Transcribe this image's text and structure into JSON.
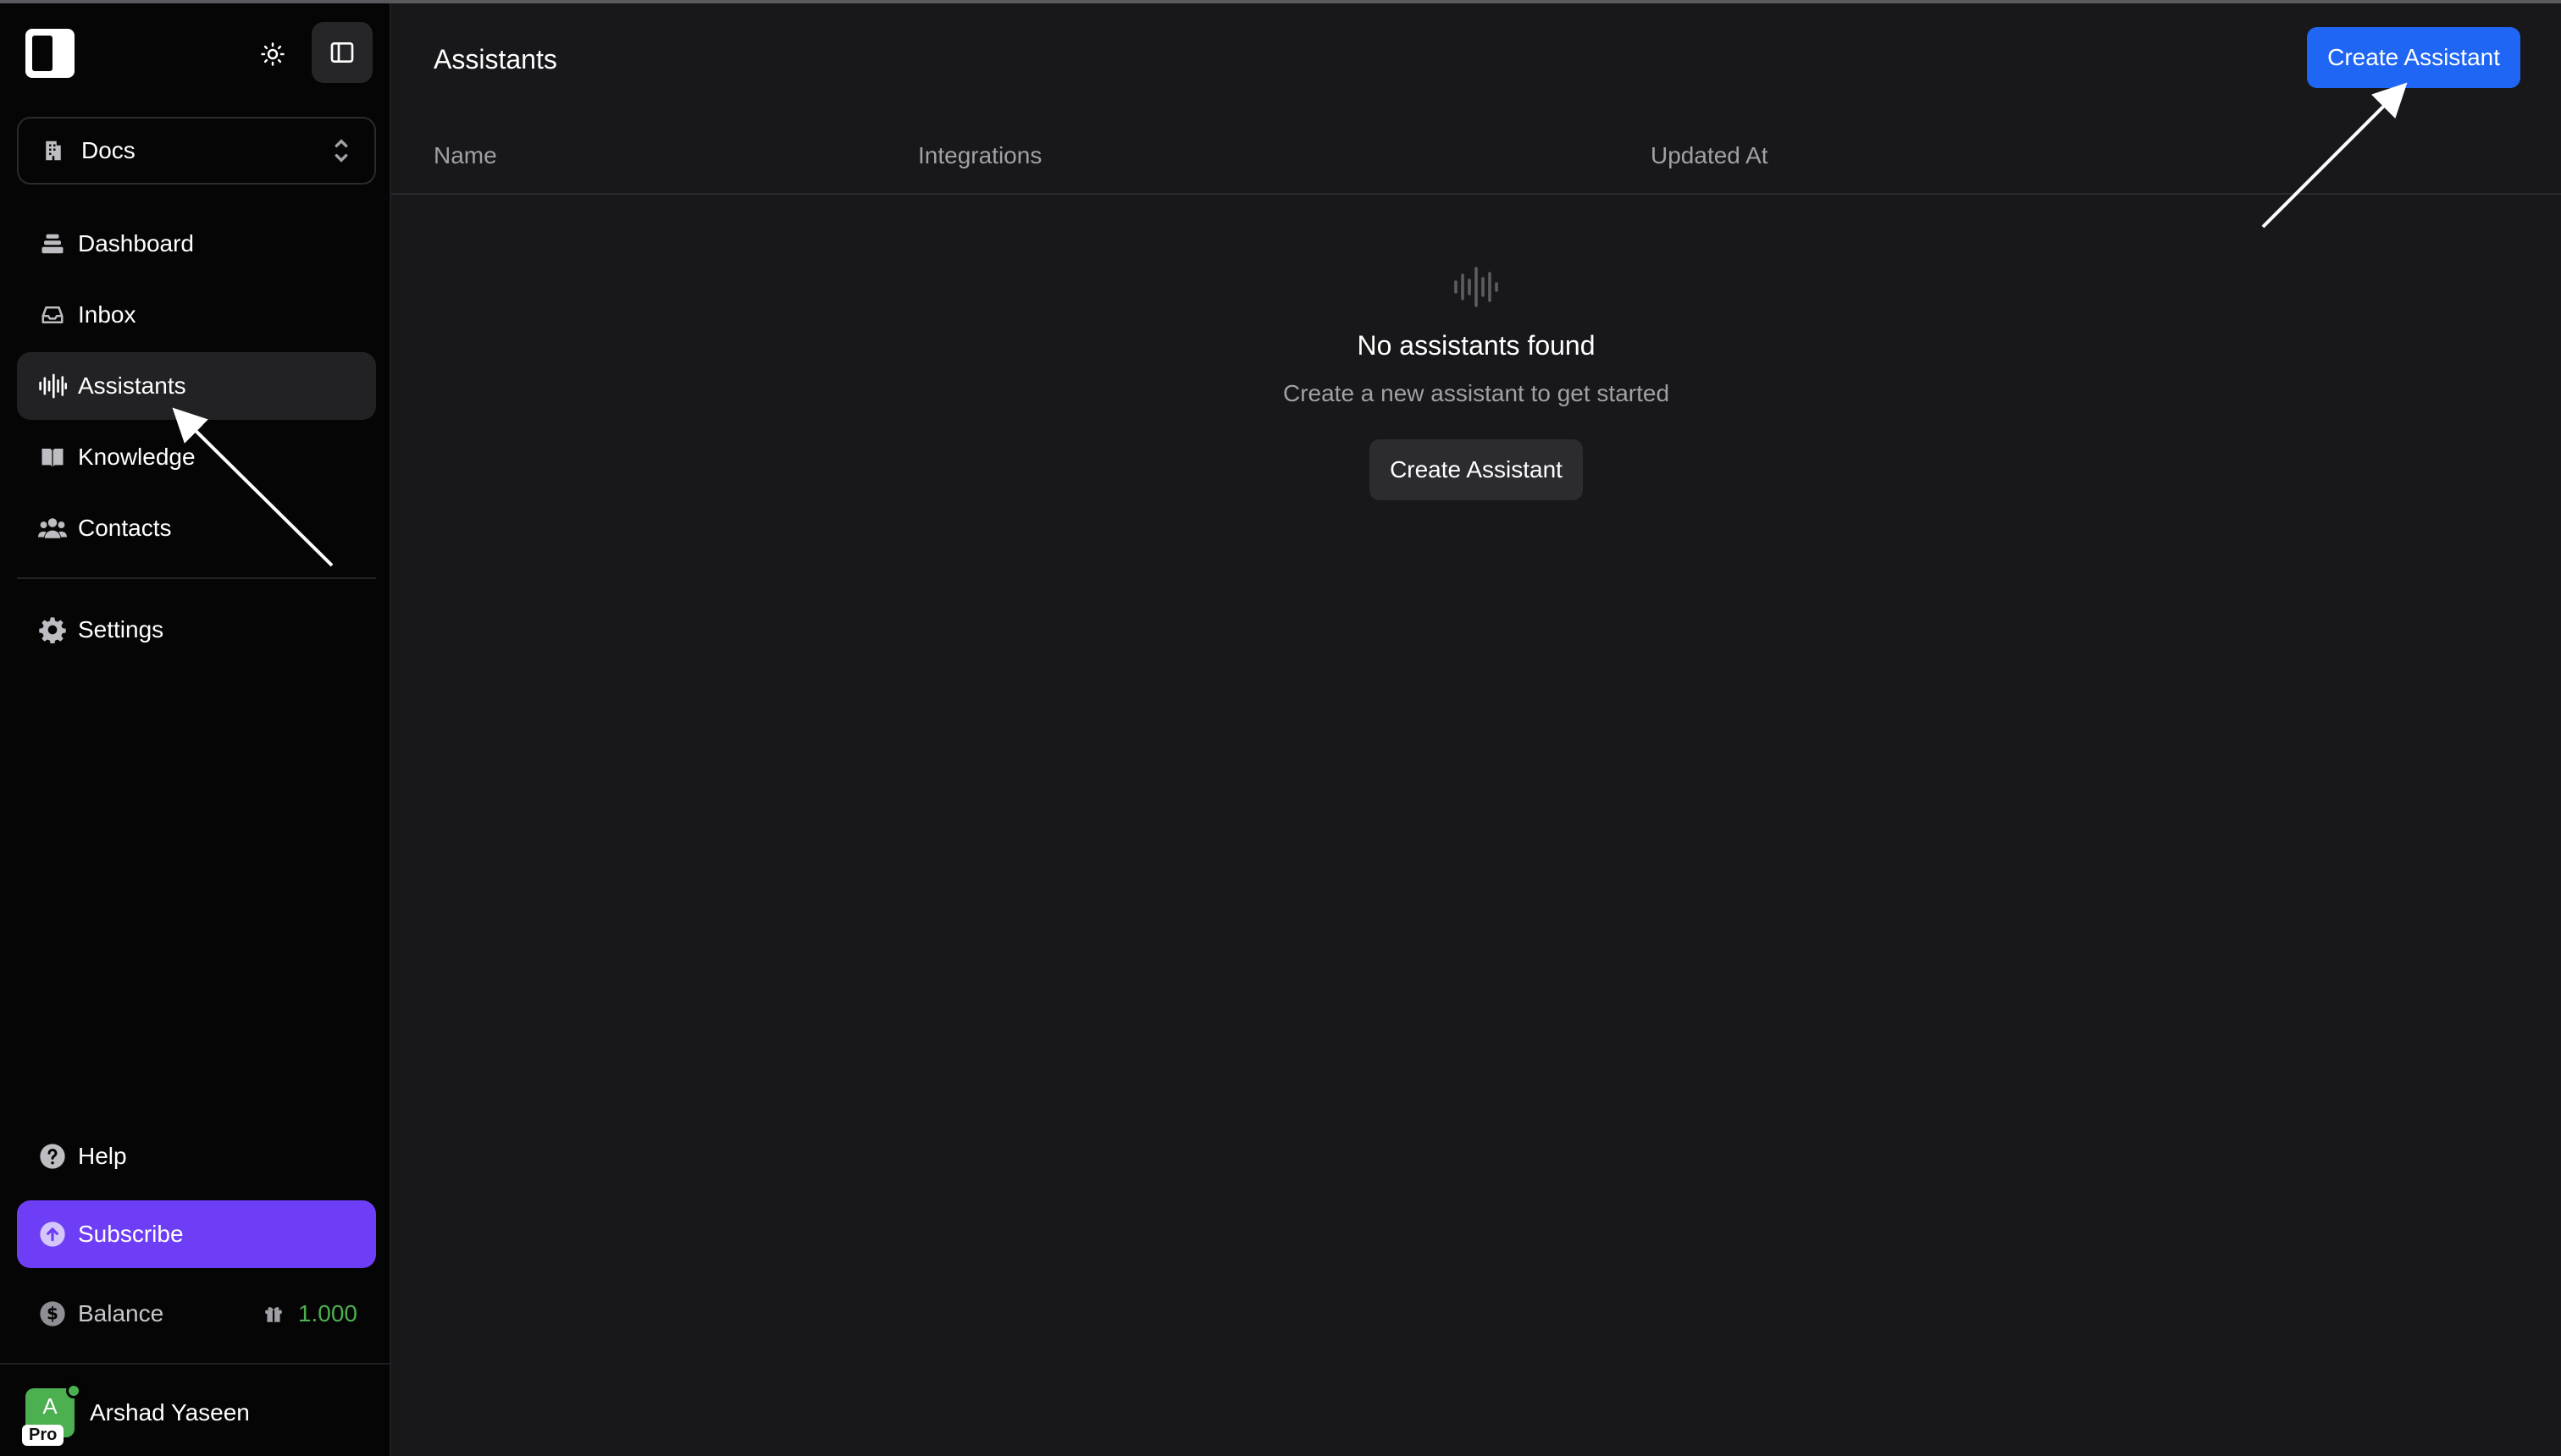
{
  "sidebar": {
    "workspace": {
      "label": "Docs"
    },
    "nav": [
      {
        "label": "Dashboard",
        "icon": "dashboard-icon"
      },
      {
        "label": "Inbox",
        "icon": "inbox-icon"
      },
      {
        "label": "Assistants",
        "icon": "waveform-icon",
        "active": true
      },
      {
        "label": "Knowledge",
        "icon": "book-icon"
      },
      {
        "label": "Contacts",
        "icon": "users-icon"
      }
    ],
    "settings": {
      "label": "Settings",
      "icon": "gear-icon"
    },
    "help": {
      "label": "Help",
      "icon": "help-icon"
    },
    "subscribe": {
      "label": "Subscribe",
      "icon": "upgrade-icon"
    },
    "balance": {
      "label": "Balance",
      "amount": "1.000",
      "icon": "dollar-icon"
    },
    "user": {
      "initial": "A",
      "name": "Arshad Yaseen",
      "badge": "Pro"
    }
  },
  "main": {
    "title": "Assistants",
    "create_button": "Create Assistant",
    "columns": [
      "Name",
      "Integrations",
      "Updated At"
    ],
    "empty": {
      "title": "No assistants found",
      "subtitle": "Create a new assistant to get started",
      "button": "Create Assistant"
    }
  },
  "colors": {
    "primary": "#1f66f5",
    "subscribe": "#6d3ef5",
    "balance_amount": "#4caf50",
    "sidebar_bg": "#050505",
    "main_bg": "#18181b"
  }
}
